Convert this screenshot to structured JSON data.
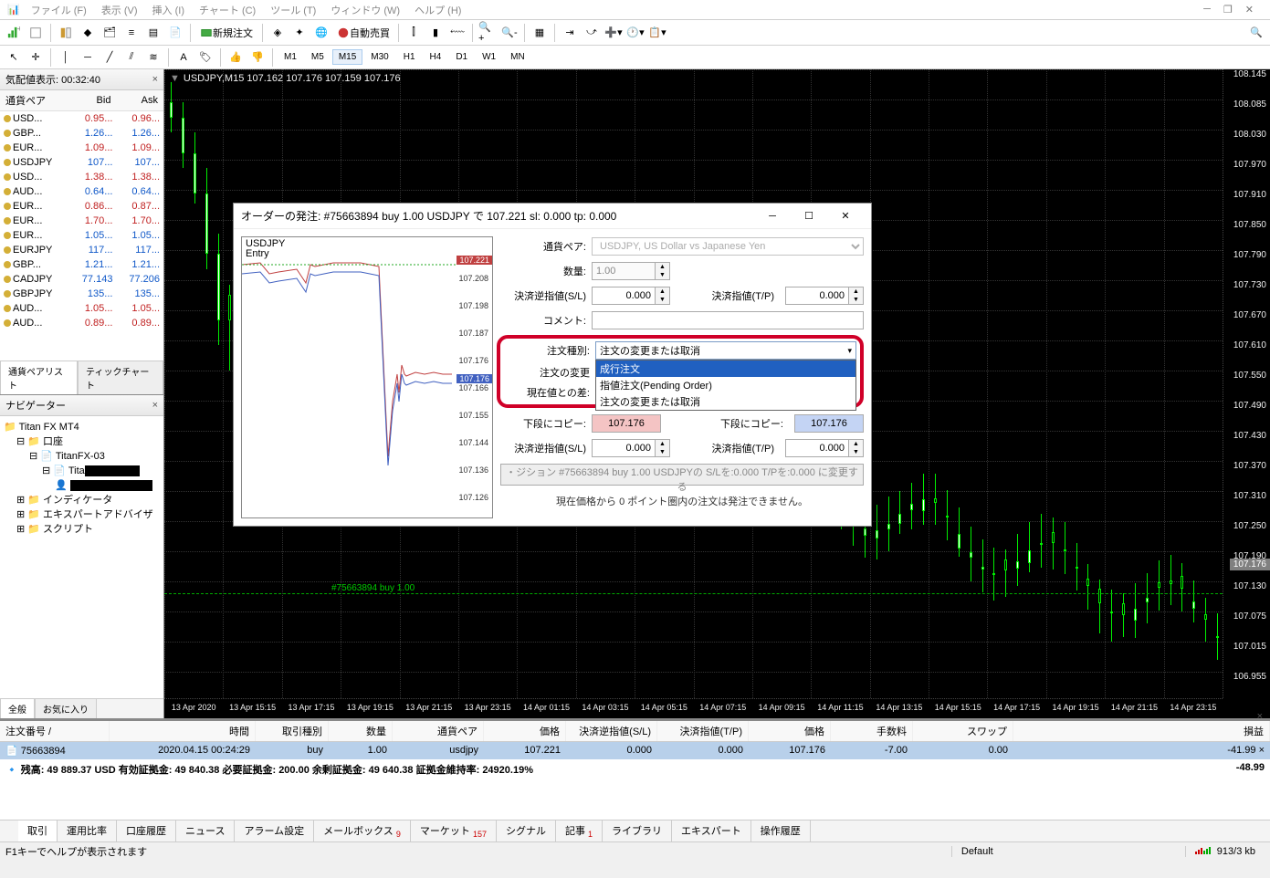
{
  "menu": {
    "file": "ファイル (F)",
    "view": "表示 (V)",
    "insert": "挿入 (I)",
    "chart": "チャート (C)",
    "tool": "ツール (T)",
    "window": "ウィンドウ (W)",
    "help": "ヘルプ (H)"
  },
  "toolbar": {
    "neworder": "新規注文",
    "autotrade": "自動売買"
  },
  "timeframes": {
    "m1": "M1",
    "m5": "M5",
    "m15": "M15",
    "m30": "M30",
    "h1": "H1",
    "h4": "H4",
    "d1": "D1",
    "w1": "W1",
    "mn": "MN"
  },
  "market_watch": {
    "title": "気配値表示: 00:32:40",
    "h_symbol": "通貨ペア",
    "h_bid": "Bid",
    "h_ask": "Ask",
    "rows": [
      {
        "s": "USD...",
        "b": "0.95...",
        "a": "0.96...",
        "bd": "dn",
        "ad": "dn"
      },
      {
        "s": "GBP...",
        "b": "1.26...",
        "a": "1.26...",
        "bd": "up",
        "ad": "up"
      },
      {
        "s": "EUR...",
        "b": "1.09...",
        "a": "1.09...",
        "bd": "dn",
        "ad": "dn"
      },
      {
        "s": "USDJPY",
        "b": "107...",
        "a": "107...",
        "bd": "up",
        "ad": "up"
      },
      {
        "s": "USD...",
        "b": "1.38...",
        "a": "1.38...",
        "bd": "dn",
        "ad": "dn"
      },
      {
        "s": "AUD...",
        "b": "0.64...",
        "a": "0.64...",
        "bd": "up",
        "ad": "up"
      },
      {
        "s": "EUR...",
        "b": "0.86...",
        "a": "0.87...",
        "bd": "dn",
        "ad": "dn"
      },
      {
        "s": "EUR...",
        "b": "1.70...",
        "a": "1.70...",
        "bd": "dn",
        "ad": "dn"
      },
      {
        "s": "EUR...",
        "b": "1.05...",
        "a": "1.05...",
        "bd": "up",
        "ad": "up"
      },
      {
        "s": "EURJPY",
        "b": "117...",
        "a": "117...",
        "bd": "up",
        "ad": "up"
      },
      {
        "s": "GBP...",
        "b": "1.21...",
        "a": "1.21...",
        "bd": "up",
        "ad": "up"
      },
      {
        "s": "CADJPY",
        "b": "77.143",
        "a": "77.206",
        "bd": "up",
        "ad": "up"
      },
      {
        "s": "GBPJPY",
        "b": "135...",
        "a": "135...",
        "bd": "up",
        "ad": "up"
      },
      {
        "s": "AUD...",
        "b": "1.05...",
        "a": "1.05...",
        "bd": "dn",
        "ad": "dn"
      },
      {
        "s": "AUD...",
        "b": "0.89...",
        "a": "0.89...",
        "bd": "dn",
        "ad": "dn"
      }
    ],
    "tab1": "通貨ペアリスト",
    "tab2": "ティックチャート"
  },
  "navigator": {
    "title": "ナビゲーター",
    "root": "Titan FX MT4",
    "accounts": "口座",
    "acct1": "TitanFX-03",
    "acct2_prefix": "Tita",
    "indicators": "インディケータ",
    "eas": "エキスパートアドバイザ",
    "scripts": "スクリプト",
    "tab1": "全般",
    "tab2": "お気に入り"
  },
  "chart": {
    "title": "USDJPY,M15  107.162 107.176 107.159 107.176",
    "order_label": "#75663894 buy 1.00",
    "price_tag": "107.176",
    "y_ticks": [
      "108.145",
      "108.085",
      "108.030",
      "107.970",
      "107.910",
      "107.850",
      "107.790",
      "107.730",
      "107.670",
      "107.610",
      "107.550",
      "107.490",
      "107.430",
      "107.370",
      "107.310",
      "107.250",
      "107.190",
      "107.130",
      "107.075",
      "107.015",
      "106.955"
    ],
    "x_ticks": [
      "13 Apr 2020",
      "13 Apr 15:15",
      "13 Apr 17:15",
      "13 Apr 19:15",
      "13 Apr 21:15",
      "13 Apr 23:15",
      "14 Apr 01:15",
      "14 Apr 03:15",
      "14 Apr 05:15",
      "14 Apr 07:15",
      "14 Apr 09:15",
      "14 Apr 11:15",
      "14 Apr 13:15",
      "14 Apr 15:15",
      "14 Apr 17:15",
      "14 Apr 19:15",
      "14 Apr 21:15",
      "14 Apr 23:15"
    ]
  },
  "dialog": {
    "title": "オーダーの発注: #75663894 buy 1.00 USDJPY で 107.221 sl: 0.000 tp: 0.000",
    "mini_sym": "USDJPY",
    "mini_entry": "Entry",
    "mini_price_ask": "107.221",
    "mini_price_bid": "107.176",
    "mini_ticks": [
      "107.208",
      "107.198",
      "107.187",
      "107.176",
      "107.166",
      "107.155",
      "107.144",
      "107.136",
      "107.126"
    ],
    "lbl_symbol": "通貨ペア:",
    "val_symbol": "USDJPY, US Dollar vs Japanese Yen",
    "lbl_volume": "数量:",
    "val_volume": "1.00",
    "lbl_sl": "決済逆指値(S/L)",
    "val_sl": "0.000",
    "lbl_tp": "決済指値(T/P)",
    "val_tp": "0.000",
    "lbl_comment": "コメント:",
    "lbl_ordertype": "注文種別:",
    "val_ordertype": "注文の変更または取消",
    "dd_opt1": "成行注文",
    "dd_opt2": "指値注文(Pending Order)",
    "dd_opt3": "注文の変更または取消",
    "lbl_modify": "注文の変更",
    "lbl_pricediff": "現在値との差:",
    "lbl_copylow1": "下段にコピー:",
    "btn_copy_red": "107.176",
    "lbl_copylow2": "下段にコピー:",
    "btn_copy_blue": "107.176",
    "lbl_sl2": "決済逆指値(S/L)",
    "val_sl2": "0.000",
    "lbl_tp2": "決済指値(T/P)",
    "val_tp2": "0.000",
    "btn_submit": "・ジション #75663894 buy 1.00 USDJPYの S/Lを:0.000 T/Pを:0.000 に変更する",
    "note": "現在価格から 0 ポイント圏内の注文は発注できません。"
  },
  "terminal": {
    "h_order": "注文番号",
    "h_time": "時間",
    "h_type": "取引種別",
    "h_vol": "数量",
    "h_sym": "通貨ペア",
    "h_price": "価格",
    "h_sl": "決済逆指値(S/L)",
    "h_tp": "決済指値(T/P)",
    "h_price2": "価格",
    "h_comm": "手数料",
    "h_swap": "スワップ",
    "h_profit": "損益",
    "r0": {
      "order": "75663894",
      "time": "2020.04.15 00:24:29",
      "type": "buy",
      "vol": "1.00",
      "sym": "usdjpy",
      "price": "107.221",
      "sl": "0.000",
      "tp": "0.000",
      "price2": "107.176",
      "comm": "-7.00",
      "swap": "0.00",
      "profit": "-41.99",
      "close": "×"
    },
    "summary": "残高: 49 889.37 USD  有効証拠金: 49 840.38  必要証拠金: 200.00  余剰証拠金: 49 640.38  証拠金維持率: 24920.19%",
    "summary_profit": "-48.99",
    "tabs": {
      "trade": "取引",
      "ratio": "運用比率",
      "history": "口座履歴",
      "news": "ニュース",
      "alarm": "アラーム設定",
      "mailbox": "メールボックス",
      "mailbox_badge": "9",
      "market": "マーケット",
      "market_badge": "157",
      "signal": "シグナル",
      "article": "記事",
      "article_badge": "1",
      "library": "ライブラリ",
      "expert": "エキスパート",
      "ophist": "操作履歴"
    }
  },
  "status": {
    "help": "F1キーでヘルプが表示されます",
    "default": "Default",
    "conn": "913/3 kb"
  }
}
